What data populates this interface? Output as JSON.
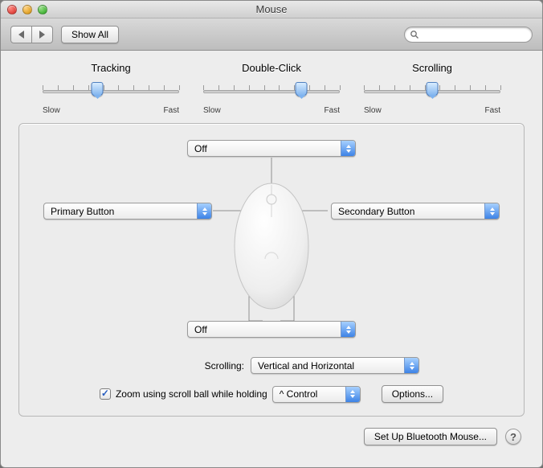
{
  "window": {
    "title": "Mouse"
  },
  "toolbar": {
    "show_all": "Show All",
    "search_placeholder": ""
  },
  "sliders": {
    "tracking": {
      "label": "Tracking",
      "slow": "Slow",
      "fast": "Fast",
      "value_pct": 40
    },
    "doubleclick": {
      "label": "Double-Click",
      "slow": "Slow",
      "fast": "Fast",
      "value_pct": 72
    },
    "scrolling": {
      "label": "Scrolling",
      "slow": "Slow",
      "fast": "Fast",
      "value_pct": 50
    }
  },
  "buttons": {
    "top": "Off",
    "left": "Primary Button",
    "right": "Secondary Button",
    "side": "Off"
  },
  "scrolling_row": {
    "label": "Scrolling:",
    "value": "Vertical and Horizontal"
  },
  "zoom": {
    "checked": true,
    "label": "Zoom using scroll ball while holding",
    "modifier": "^ Control",
    "options_btn": "Options..."
  },
  "footer": {
    "bt_btn": "Set Up Bluetooth Mouse..."
  }
}
